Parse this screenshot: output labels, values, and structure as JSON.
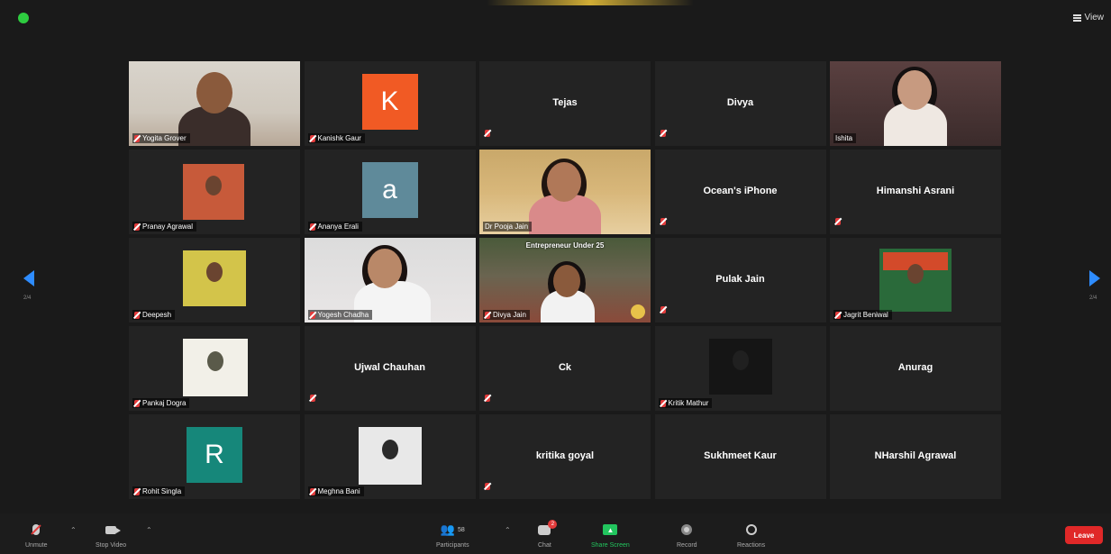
{
  "topbar": {
    "view_label": "View"
  },
  "participants": [
    {
      "name": "Yogita Grover",
      "type": "video",
      "muted": true
    },
    {
      "name": "Kanishk Gaur",
      "type": "letter",
      "letter": "K",
      "color": "#f15a24",
      "muted": true
    },
    {
      "name": "Tejas",
      "type": "name",
      "muted": true
    },
    {
      "name": "Divya",
      "type": "name",
      "muted": true
    },
    {
      "name": "Ishita",
      "type": "video",
      "muted": false
    },
    {
      "name": "Pranay Agrawal",
      "type": "photo",
      "muted": true
    },
    {
      "name": "Ananya Erali",
      "type": "letter",
      "letter": "a",
      "color": "#5f8a9a",
      "muted": true
    },
    {
      "name": "Dr Pooja Jain",
      "type": "video",
      "muted": false,
      "active": true
    },
    {
      "name": "Ocean's iPhone",
      "type": "name",
      "muted": true
    },
    {
      "name": "Himanshi Asrani",
      "type": "name",
      "muted": true
    },
    {
      "name": "Deepesh",
      "type": "photo",
      "muted": true
    },
    {
      "name": "Yogesh Chadha",
      "type": "video",
      "muted": true
    },
    {
      "name": "Divya Jain",
      "type": "video",
      "muted": true,
      "banner": "Entrepreneur Under 25"
    },
    {
      "name": "Pulak Jain",
      "type": "name",
      "muted": true
    },
    {
      "name": "Jagrit Beniwal",
      "type": "photo",
      "muted": true
    },
    {
      "name": "Pankaj Dogra",
      "type": "photo",
      "muted": true
    },
    {
      "name": "Ujwal Chauhan",
      "type": "name",
      "muted": true
    },
    {
      "name": "Ck",
      "type": "name",
      "muted": true
    },
    {
      "name": "Kritik Mathur",
      "type": "photo",
      "muted": true
    },
    {
      "name": "Anurag",
      "type": "name",
      "muted": false
    },
    {
      "name": "Rohit Singla",
      "type": "letter",
      "letter": "R",
      "color": "#16877a",
      "muted": true
    },
    {
      "name": "Meghna Bani",
      "type": "photo",
      "muted": true
    },
    {
      "name": "kritika goyal",
      "type": "name",
      "muted": true
    },
    {
      "name": "Sukhmeet Kaur",
      "type": "name",
      "muted": false
    },
    {
      "name": "NHarshil Agrawal",
      "type": "name",
      "muted": false
    }
  ],
  "nav": {
    "left_page": "2/4",
    "right_page": "2/4"
  },
  "toolbar": {
    "unmute": "Unmute",
    "stop_video": "Stop Video",
    "participants": "Participants",
    "participants_count": "58",
    "chat": "Chat",
    "chat_badge": "2",
    "share_screen": "Share Screen",
    "record": "Record",
    "reactions": "Reactions",
    "leave": "Leave"
  },
  "colors": {
    "accent_blue": "#2e8cff",
    "active_border": "#c8d62a",
    "leave_red": "#e02828",
    "share_green": "#22c55e"
  }
}
